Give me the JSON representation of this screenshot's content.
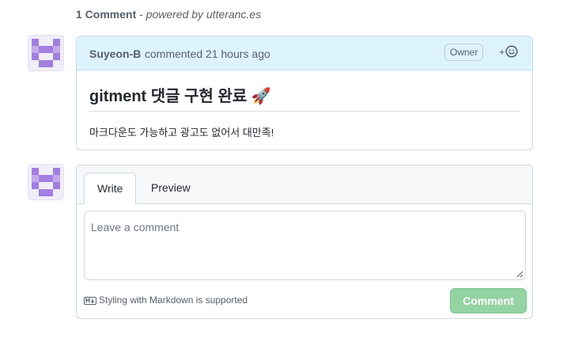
{
  "header": {
    "count": "1 Comment",
    "powered": "- powered by utteranc.es"
  },
  "comment": {
    "author": "Suyeon-B",
    "action": "commented 21 hours ago",
    "badge": "Owner",
    "reaction_label": "+",
    "title": "gitment 댓글 구현 완료 🚀",
    "body": "마크다운도 가능하고 광고도 없어서 대만족!"
  },
  "editor": {
    "tabs": [
      "Write",
      "Preview"
    ],
    "placeholder": "Leave a comment",
    "markdown_note": "Styling with Markdown is supported",
    "submit_label": "Comment"
  },
  "colors": {
    "head_blue": "#ddf4ff",
    "submit_green": "#94d3a2",
    "avatar_purple": "#a37ee2"
  },
  "icons": [
    "avatar-identicon",
    "smiley-icon",
    "markdown-icon",
    "resize-handle-icon"
  ]
}
